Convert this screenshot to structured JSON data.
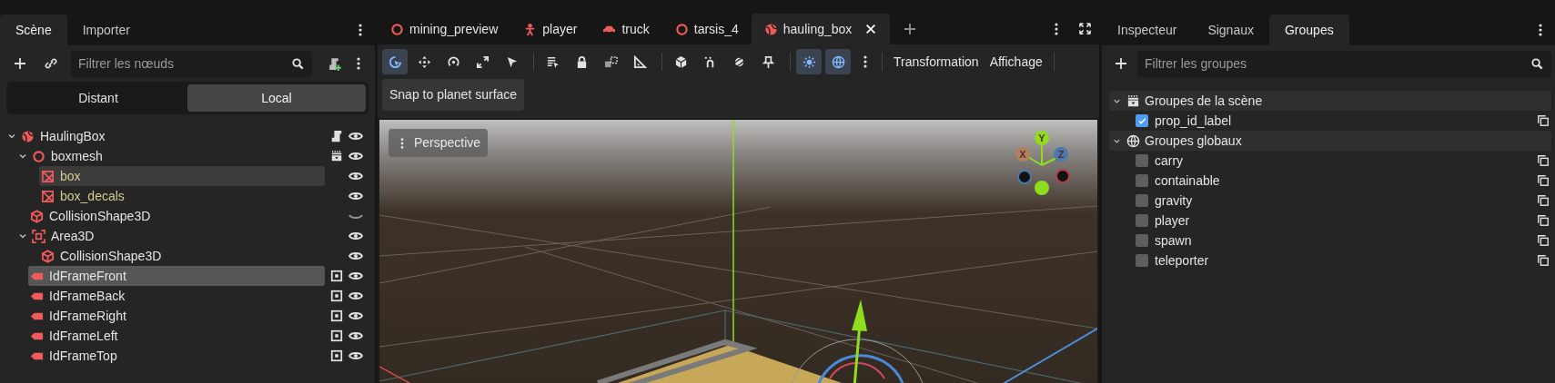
{
  "scene_panel": {
    "tabs": [
      {
        "label": "Scène",
        "selected": true
      },
      {
        "label": "Importer",
        "selected": false
      }
    ],
    "filter": {
      "placeholder": "Filtrer les nœuds"
    },
    "mode_switch": [
      {
        "label": "Distant",
        "selected": false
      },
      {
        "label": "Local",
        "selected": true
      }
    ],
    "tree": [
      {
        "name": "HaulingBox",
        "kind": "node3d",
        "script": true,
        "scene_badge": false,
        "billboard": false,
        "visible": true,
        "selected": false,
        "hovered": false,
        "inherited": false,
        "expanded": true,
        "children": [
          {
            "name": "boxmesh",
            "kind": "scene",
            "script": false,
            "scene_badge": true,
            "billboard": false,
            "visible": true,
            "selected": false,
            "hovered": false,
            "inherited": false,
            "expanded": true,
            "children": [
              {
                "name": "box",
                "kind": "mesh",
                "script": false,
                "scene_badge": false,
                "billboard": false,
                "visible": true,
                "selected": false,
                "hovered": true,
                "inherited": true
              },
              {
                "name": "box_decals",
                "kind": "mesh",
                "script": false,
                "scene_badge": false,
                "billboard": false,
                "visible": true,
                "selected": false,
                "hovered": false,
                "inherited": true
              }
            ]
          },
          {
            "name": "CollisionShape3D",
            "kind": "collision",
            "script": false,
            "scene_badge": false,
            "billboard": false,
            "visible": false,
            "selected": false,
            "hovered": false,
            "inherited": false
          },
          {
            "name": "Area3D",
            "kind": "area",
            "script": false,
            "scene_badge": false,
            "billboard": false,
            "visible": true,
            "selected": false,
            "hovered": false,
            "inherited": false,
            "expanded": true,
            "children": [
              {
                "name": "CollisionShape3D",
                "kind": "collision",
                "script": false,
                "scene_badge": false,
                "billboard": false,
                "visible": true,
                "selected": false,
                "hovered": false,
                "inherited": false
              }
            ]
          },
          {
            "name": "IdFrameFront",
            "kind": "label3d",
            "script": false,
            "scene_badge": false,
            "billboard": true,
            "visible": true,
            "selected": true,
            "hovered": false,
            "inherited": false
          },
          {
            "name": "IdFrameBack",
            "kind": "label3d",
            "script": false,
            "scene_badge": false,
            "billboard": true,
            "visible": true,
            "selected": false,
            "hovered": false,
            "inherited": false
          },
          {
            "name": "IdFrameRight",
            "kind": "label3d",
            "script": false,
            "scene_badge": false,
            "billboard": true,
            "visible": true,
            "selected": false,
            "hovered": false,
            "inherited": false
          },
          {
            "name": "IdFrameLeft",
            "kind": "label3d",
            "script": false,
            "scene_badge": false,
            "billboard": true,
            "visible": true,
            "selected": false,
            "hovered": false,
            "inherited": false
          },
          {
            "name": "IdFrameTop",
            "kind": "label3d",
            "script": false,
            "scene_badge": false,
            "billboard": true,
            "visible": true,
            "selected": false,
            "hovered": false,
            "inherited": false
          }
        ]
      }
    ]
  },
  "editor": {
    "doc_tabs": [
      {
        "label": "mining_preview",
        "kind": "scene",
        "selected": false
      },
      {
        "label": "player",
        "kind": "character",
        "selected": false
      },
      {
        "label": "truck",
        "kind": "vehicle",
        "selected": false
      },
      {
        "label": "tarsis_4",
        "kind": "scene",
        "selected": false
      },
      {
        "label": "hauling_box",
        "kind": "node3d",
        "selected": true
      }
    ],
    "tool_groups": [
      [
        {
          "kind": "select",
          "selected": true
        },
        {
          "kind": "move",
          "selected": false
        },
        {
          "kind": "rotate",
          "selected": false
        },
        {
          "kind": "scale",
          "selected": false
        },
        {
          "kind": "pointer",
          "selected": false
        }
      ],
      [
        {
          "kind": "list",
          "selected": false
        },
        {
          "kind": "lock",
          "selected": false
        },
        {
          "kind": "group",
          "selected": false
        },
        {
          "kind": "ruler",
          "selected": false
        }
      ],
      [
        {
          "kind": "cube",
          "selected": false
        },
        {
          "kind": "snap",
          "selected": false
        },
        {
          "kind": "planet",
          "selected": false
        },
        {
          "kind": "pin",
          "selected": false
        }
      ],
      [
        {
          "kind": "sun",
          "selected": true
        },
        {
          "kind": "globe",
          "selected": true
        }
      ]
    ],
    "menus": [
      "Transformation",
      "Affichage"
    ],
    "tooltip": "Snap to planet surface",
    "viewport": {
      "view_menu": "Perspective",
      "axis_labels": [
        "X",
        "Y",
        "Z"
      ]
    }
  },
  "inspector_panel": {
    "tabs": [
      {
        "label": "Inspecteur",
        "selected": false
      },
      {
        "label": "Signaux",
        "selected": false
      },
      {
        "label": "Groupes",
        "selected": true
      }
    ],
    "filter": {
      "placeholder": "Filtrer les groupes"
    },
    "sections": [
      {
        "title": "Groupes de la scène",
        "kind": "scene",
        "expanded": true,
        "groups": [
          {
            "name": "prop_id_label",
            "checked": true
          }
        ]
      },
      {
        "title": "Groupes globaux",
        "kind": "global",
        "expanded": true,
        "groups": [
          {
            "name": "carry",
            "checked": false
          },
          {
            "name": "containable",
            "checked": false
          },
          {
            "name": "gravity",
            "checked": false
          },
          {
            "name": "player",
            "checked": false
          },
          {
            "name": "spawn",
            "checked": false
          },
          {
            "name": "teleporter",
            "checked": false
          }
        ]
      }
    ]
  }
}
